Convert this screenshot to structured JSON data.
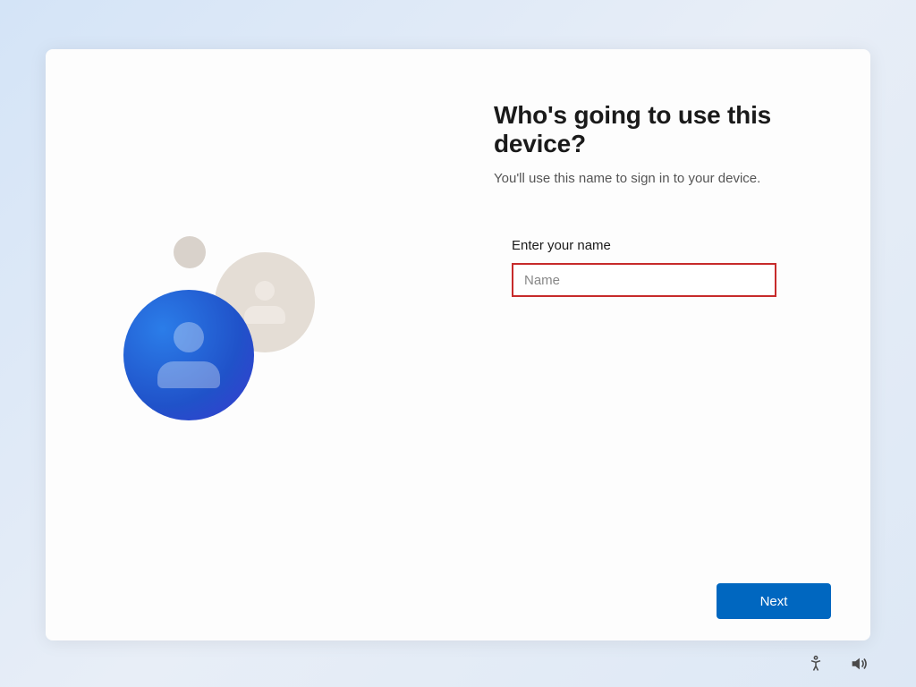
{
  "title": "Who's going to use this device?",
  "subtitle": "You'll use this name to sign in to your device.",
  "form": {
    "name_label": "Enter your name",
    "name_placeholder": "Name",
    "name_value": ""
  },
  "buttons": {
    "next": "Next"
  },
  "icons": {
    "accessibility": "accessibility",
    "volume": "volume"
  }
}
